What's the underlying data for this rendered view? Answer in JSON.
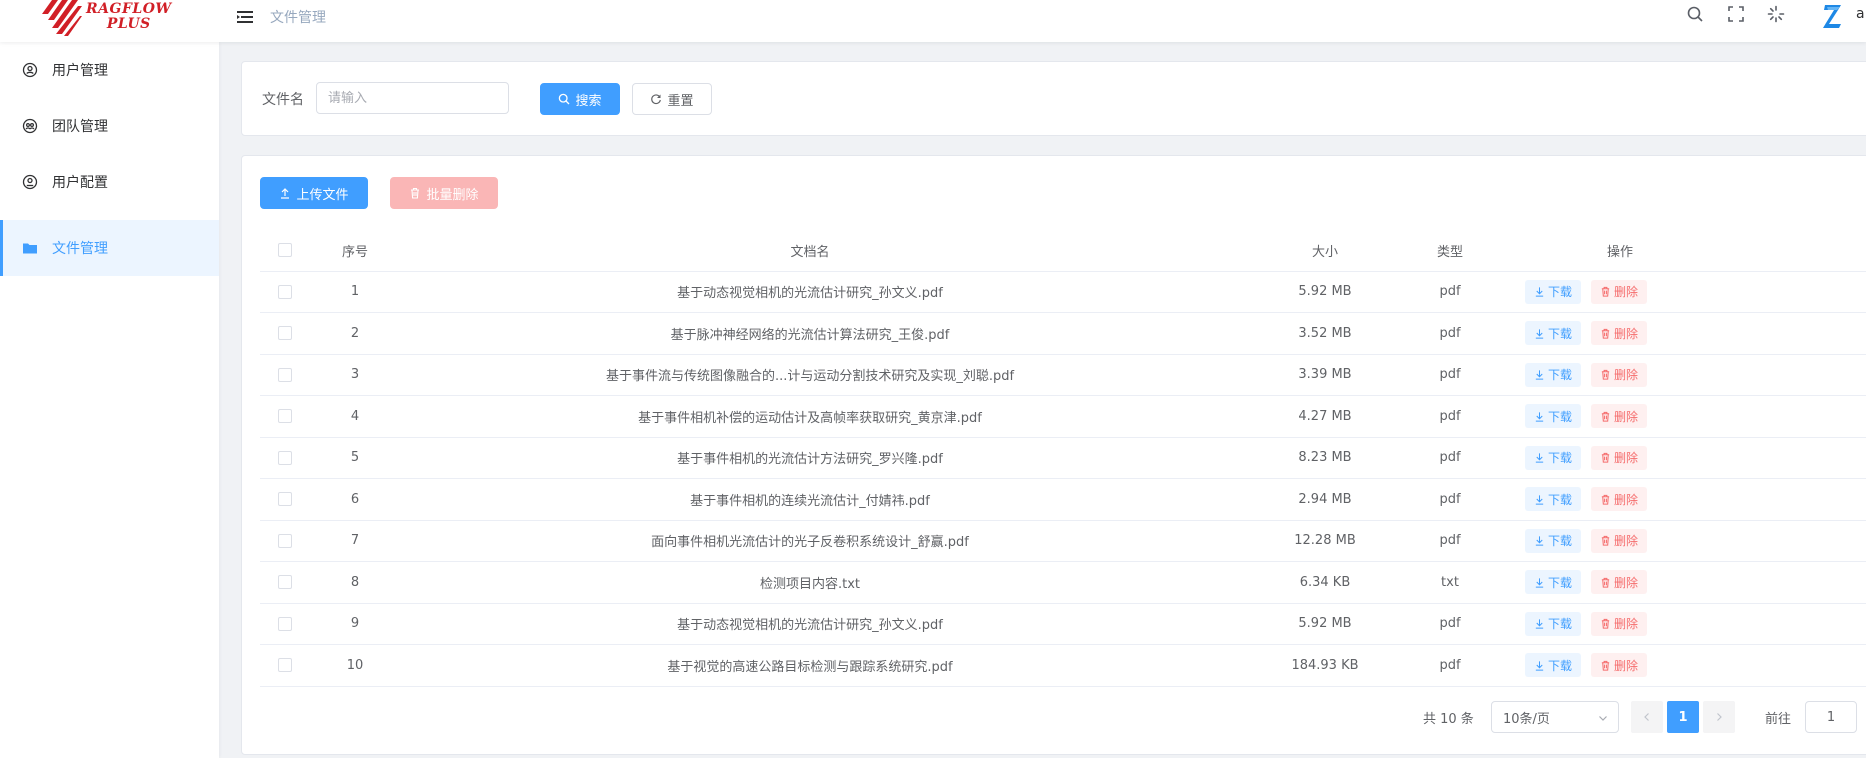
{
  "app": {
    "logo_line1": "RAGFLOW",
    "logo_line2": "PLUS",
    "breadcrumb": "文件管理",
    "username": "a",
    "accent": "#409eff",
    "danger": "#f56c6c"
  },
  "sidebar": {
    "items": [
      {
        "label": "用户管理",
        "icon": "user-icon"
      },
      {
        "label": "团队管理",
        "icon": "team-icon"
      },
      {
        "label": "用户配置",
        "icon": "user-config-icon"
      },
      {
        "label": "文件管理",
        "icon": "folder-icon",
        "active": true
      }
    ]
  },
  "search": {
    "label": "文件名",
    "placeholder": "请输入",
    "value": "",
    "search_label": "搜索",
    "reset_label": "重置"
  },
  "toolbar": {
    "upload_label": "上传文件",
    "batch_delete_label": "批量删除"
  },
  "table": {
    "columns": [
      "序号",
      "文档名",
      "大小",
      "类型",
      "操作"
    ],
    "download_label": "下载",
    "delete_label": "删除",
    "rows": [
      {
        "index": "1",
        "name": "基于动态视觉相机的光流估计研究_孙文义.pdf",
        "size": "5.92 MB",
        "type": "pdf"
      },
      {
        "index": "2",
        "name": "基于脉冲神经网络的光流估计算法研究_王俊.pdf",
        "size": "3.52 MB",
        "type": "pdf"
      },
      {
        "index": "3",
        "name": "基于事件流与传统图像融合的...计与运动分割技术研究及实现_刘聪.pdf",
        "size": "3.39 MB",
        "type": "pdf"
      },
      {
        "index": "4",
        "name": "基于事件相机补偿的运动估计及高帧率获取研究_黄京津.pdf",
        "size": "4.27 MB",
        "type": "pdf"
      },
      {
        "index": "5",
        "name": "基于事件相机的光流估计方法研究_罗兴隆.pdf",
        "size": "8.23 MB",
        "type": "pdf"
      },
      {
        "index": "6",
        "name": "基于事件相机的连续光流估计_付婧祎.pdf",
        "size": "2.94 MB",
        "type": "pdf"
      },
      {
        "index": "7",
        "name": "面向事件相机光流估计的光子反卷积系统设计_舒赢.pdf",
        "size": "12.28 MB",
        "type": "pdf"
      },
      {
        "index": "8",
        "name": "检测项目内容.txt",
        "size": "6.34 KB",
        "type": "txt"
      },
      {
        "index": "9",
        "name": "基于动态视觉相机的光流估计研究_孙文义.pdf",
        "size": "5.92 MB",
        "type": "pdf"
      },
      {
        "index": "10",
        "name": "基于视觉的高速公路目标检测与跟踪系统研究.pdf",
        "size": "184.93 KB",
        "type": "pdf"
      }
    ]
  },
  "pagination": {
    "total_text": "共 10 条",
    "page_size": "10条/页",
    "current_page": "1",
    "goto_label": "前往",
    "goto_value": "1"
  }
}
